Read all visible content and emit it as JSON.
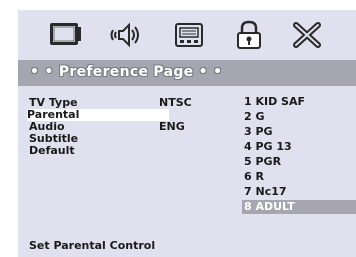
{
  "tabs": [
    {
      "name": "general-setup",
      "icon": "tv-screen-icon"
    },
    {
      "name": "audio-setup",
      "icon": "speaker-icon"
    },
    {
      "name": "video-setup",
      "icon": "video-panel-icon"
    },
    {
      "name": "preference-setup",
      "icon": "lock-icon"
    },
    {
      "name": "exit",
      "icon": "x-icon"
    }
  ],
  "header": {
    "title": "• • Preference Page • •"
  },
  "menu": [
    {
      "label": "TV Type",
      "value": "NTSC"
    },
    {
      "label": "Parental",
      "value": ""
    },
    {
      "label": "Audio",
      "value": "ENG"
    },
    {
      "label": "Subtitle",
      "value": ""
    },
    {
      "label": "Default",
      "value": ""
    }
  ],
  "selected_menu_index": 1,
  "ratings": [
    "1 KID SAF",
    "2 G",
    "3 PG",
    "4 PG 13",
    "5 PGR",
    "6 R",
    "7 Nc17",
    "8 ADULT"
  ],
  "selected_rating_index": 7,
  "footer": {
    "hint": "Set Parental Control"
  },
  "colors": {
    "background": "#dfe1ee",
    "highlight": "#a5a6b0",
    "text": "#1a1a1a"
  }
}
